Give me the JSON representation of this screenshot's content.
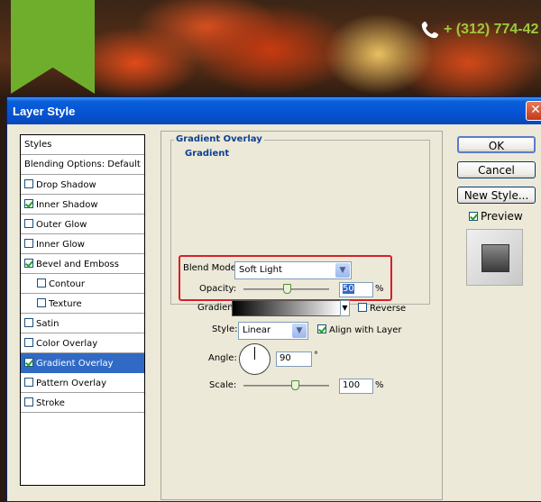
{
  "background": {
    "phone": "+ (312) 774-42"
  },
  "dialog": {
    "title": "Layer Style",
    "close": "✕"
  },
  "styles_list": [
    {
      "label": "Styles",
      "checkbox": false,
      "checked": false,
      "sub": false,
      "selected": false
    },
    {
      "label": "Blending Options: Default",
      "checkbox": false,
      "checked": false,
      "sub": false,
      "selected": false
    },
    {
      "label": "Drop Shadow",
      "checkbox": true,
      "checked": false,
      "sub": false,
      "selected": false
    },
    {
      "label": "Inner Shadow",
      "checkbox": true,
      "checked": true,
      "sub": false,
      "selected": false
    },
    {
      "label": "Outer Glow",
      "checkbox": true,
      "checked": false,
      "sub": false,
      "selected": false
    },
    {
      "label": "Inner Glow",
      "checkbox": true,
      "checked": false,
      "sub": false,
      "selected": false
    },
    {
      "label": "Bevel and Emboss",
      "checkbox": true,
      "checked": true,
      "sub": false,
      "selected": false
    },
    {
      "label": "Contour",
      "checkbox": true,
      "checked": false,
      "sub": true,
      "selected": false
    },
    {
      "label": "Texture",
      "checkbox": true,
      "checked": false,
      "sub": true,
      "selected": false
    },
    {
      "label": "Satin",
      "checkbox": true,
      "checked": false,
      "sub": false,
      "selected": false
    },
    {
      "label": "Color Overlay",
      "checkbox": true,
      "checked": false,
      "sub": false,
      "selected": false
    },
    {
      "label": "Gradient Overlay",
      "checkbox": true,
      "checked": true,
      "sub": false,
      "selected": true
    },
    {
      "label": "Pattern Overlay",
      "checkbox": true,
      "checked": false,
      "sub": false,
      "selected": false
    },
    {
      "label": "Stroke",
      "checkbox": true,
      "checked": false,
      "sub": false,
      "selected": false
    }
  ],
  "panel": {
    "title": "Gradient Overlay",
    "subtitle": "Gradient",
    "blend_mode_label": "Blend Mode:",
    "blend_mode_value": "Soft Light",
    "opacity_label": "Opacity:",
    "opacity_value": "50",
    "opacity_unit": "%",
    "opacity_level": 0.5,
    "gradient_label": "Gradient:",
    "reverse_label": "Reverse",
    "reverse_checked": false,
    "style_label": "Style:",
    "style_value": "Linear",
    "align_label": "Align with Layer",
    "align_checked": true,
    "angle_label": "Angle:",
    "angle_value": "90",
    "angle_unit": "°",
    "scale_label": "Scale:",
    "scale_value": "100",
    "scale_unit": "%",
    "scale_level": 0.6
  },
  "buttons": {
    "ok": "OK",
    "cancel": "Cancel",
    "new_style": "New Style...",
    "preview_label": "Preview",
    "preview_checked": true
  },
  "colors": {
    "highlight": "#d81e28",
    "selection": "#316ac5",
    "title_blue": "#0d3f94",
    "ribbon": "#6fae2c"
  }
}
